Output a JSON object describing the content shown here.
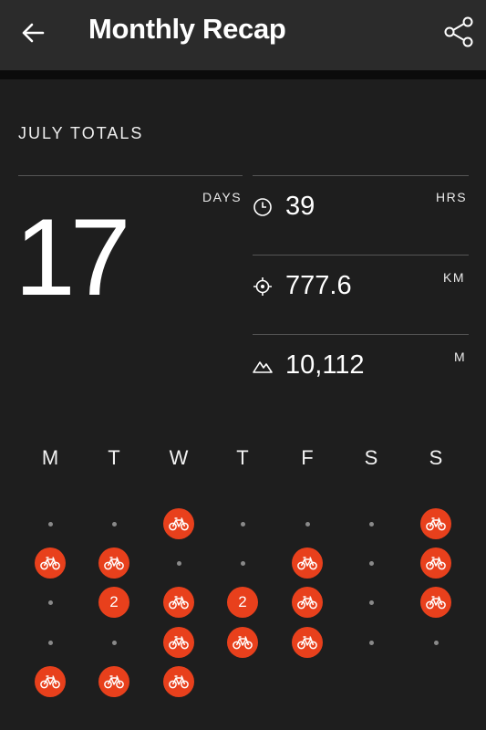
{
  "header": {
    "title": "Monthly Recap",
    "back_icon": "back-arrow-icon",
    "share_icon": "share-icon"
  },
  "totals": {
    "section_title": "JULY TOTALS",
    "days_label": "DAYS",
    "days_value": "17",
    "stats": [
      {
        "icon": "clock-icon",
        "value": "39",
        "unit": "HRS"
      },
      {
        "icon": "target-icon",
        "value": "777.6",
        "unit": "KM"
      },
      {
        "icon": "mountain-icon",
        "value": "10,112",
        "unit": "M"
      }
    ]
  },
  "calendar": {
    "weekdays": [
      "M",
      "T",
      "W",
      "T",
      "F",
      "S",
      "S"
    ],
    "accent_color": "#e8401c",
    "weeks": [
      [
        "dot",
        "dot",
        "bike",
        "dot",
        "dot",
        "dot",
        "bike"
      ],
      [
        "bike",
        "bike",
        "dot",
        "dot",
        "bike",
        "dot",
        "bike"
      ],
      [
        "dot",
        "2",
        "bike",
        "2",
        "bike",
        "dot",
        "bike"
      ],
      [
        "dot",
        "dot",
        "bike",
        "bike",
        "bike",
        "dot",
        "dot"
      ],
      [
        "bike",
        "bike",
        "bike",
        "",
        "",
        "",
        ""
      ]
    ]
  }
}
